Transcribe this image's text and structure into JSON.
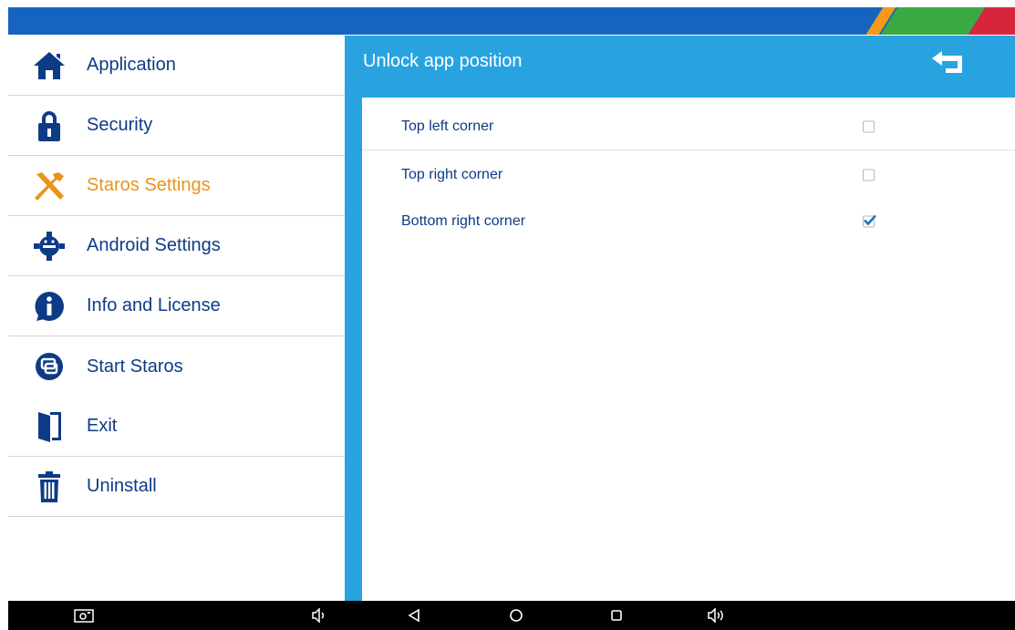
{
  "colors": {
    "top_bar": "#1565c0",
    "content_bg": "#29a3e0",
    "menu_text": "#0d3b86",
    "active_text": "#e8941a",
    "icon_blue": "#0d3b86",
    "icon_orange": "#e8941a",
    "stripe_orange": "#f29a1e",
    "stripe_green": "#3aa944",
    "stripe_red": "#d6263c",
    "nav_bg": "#000000"
  },
  "sidebar": {
    "items": [
      {
        "label": "Application",
        "icon": "home-icon",
        "active": false
      },
      {
        "label": "Security",
        "icon": "lock-icon",
        "active": false
      },
      {
        "label": "Staros Settings",
        "icon": "tools-icon",
        "active": true
      },
      {
        "label": "Android Settings",
        "icon": "android-gear-icon",
        "active": false
      },
      {
        "label": "Info and License",
        "icon": "info-icon",
        "active": false
      },
      {
        "label": "Start Staros",
        "icon": "start-staros-icon",
        "active": false
      },
      {
        "label": "Exit",
        "icon": "door-exit-icon",
        "active": false
      },
      {
        "label": "Uninstall",
        "icon": "trash-icon",
        "active": false
      }
    ]
  },
  "content": {
    "title": "Unlock app position",
    "back_icon": "back-arrow-icon",
    "options": [
      {
        "label": "Top left corner",
        "checked": false
      },
      {
        "label": "Top right corner",
        "checked": false
      },
      {
        "label": "Bottom right corner",
        "checked": true
      }
    ]
  },
  "navbar": {
    "buttons": [
      "screenshot-icon",
      "volume-down-icon",
      "back-nav-icon",
      "home-nav-icon",
      "recents-nav-icon",
      "volume-up-icon"
    ]
  }
}
